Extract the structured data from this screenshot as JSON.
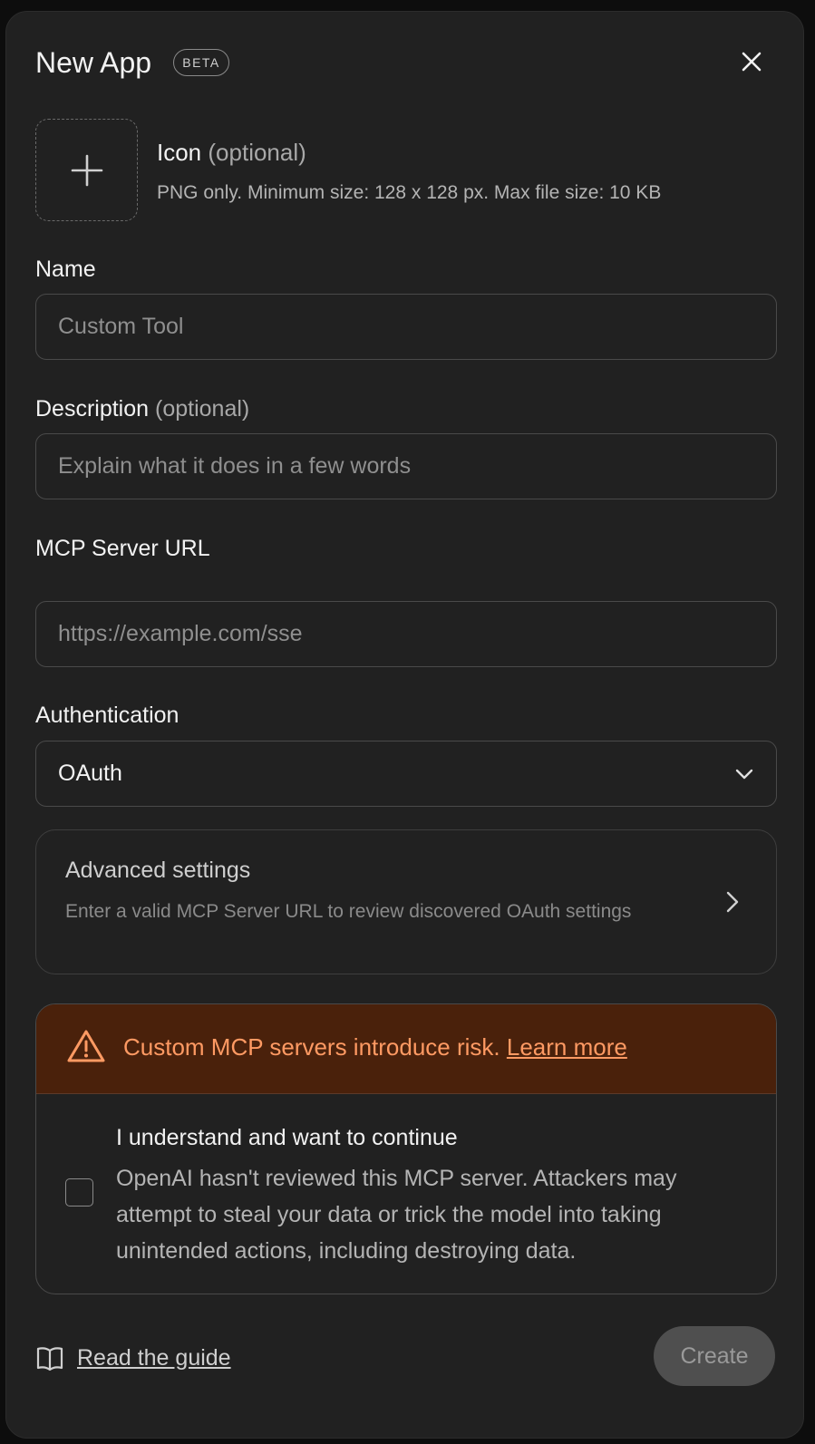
{
  "header": {
    "title": "New App",
    "badge": "BETA"
  },
  "icon_upload": {
    "title": "Icon",
    "optional": "(optional)",
    "hint": "PNG only. Minimum size: 128 x 128 px. Max file size: 10 KB"
  },
  "name": {
    "label": "Name",
    "placeholder": "Custom Tool"
  },
  "description": {
    "label": "Description",
    "optional": "(optional)",
    "placeholder": "Explain what it does in a few words"
  },
  "mcp": {
    "label": "MCP Server URL",
    "placeholder": "https://example.com/sse"
  },
  "auth": {
    "label": "Authentication",
    "value": "OAuth"
  },
  "advanced": {
    "title": "Advanced settings",
    "description": "Enter a valid MCP Server URL to review discovered OAuth settings"
  },
  "warning": {
    "text": "Custom MCP servers introduce risk.",
    "link": "Learn more",
    "accent": "#ff9a63"
  },
  "acknowledge": {
    "title": "I understand and want to continue",
    "body": "OpenAI hasn't reviewed this MCP server. Attackers may attempt to steal your data or trick the model into taking unintended actions, including destroying data."
  },
  "footer": {
    "guide_label": "Read the guide",
    "create_label": "Create"
  }
}
